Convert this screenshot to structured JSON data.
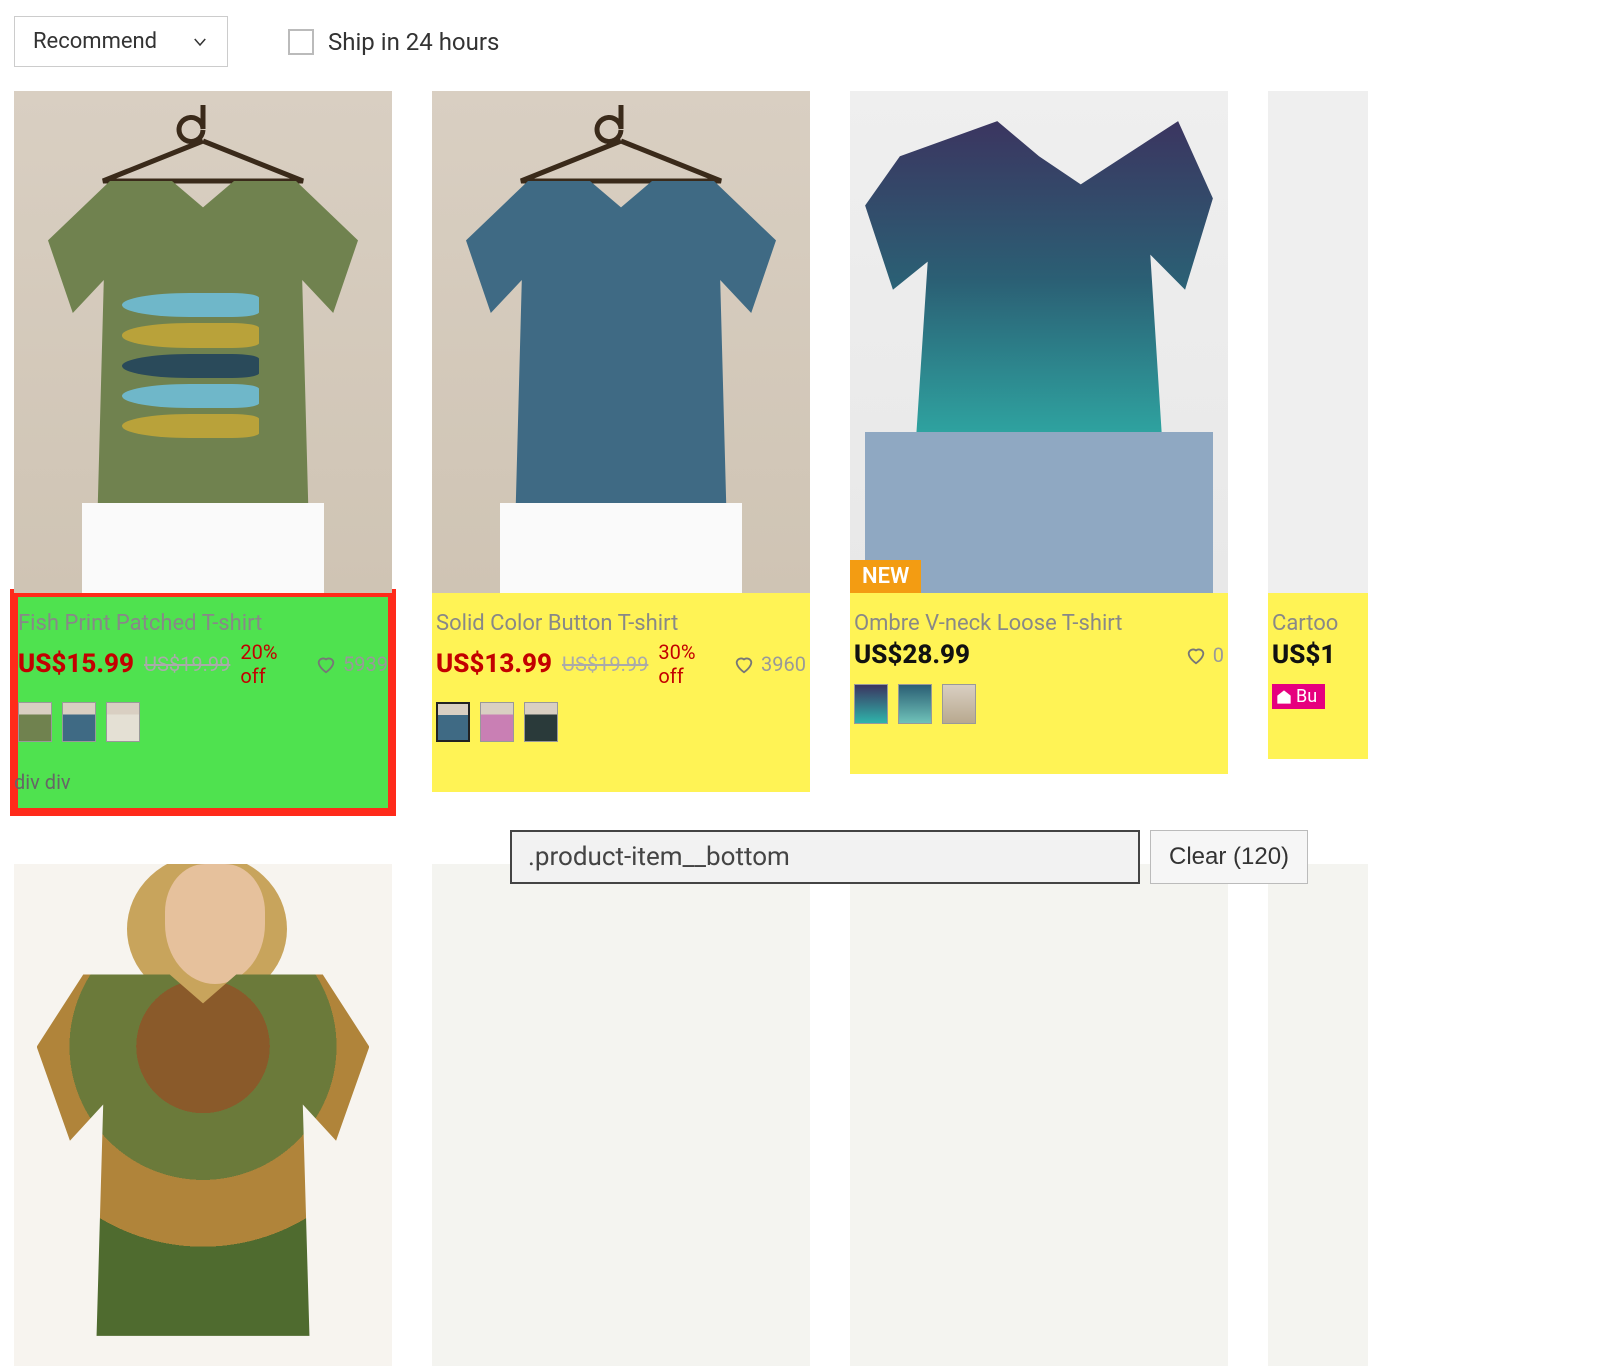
{
  "topbar": {
    "sort_label": "Recommend",
    "ship_label": "Ship in 24 hours"
  },
  "selector_bar": {
    "input_value": ".product-item__bottom",
    "clear_label": "Clear (120)"
  },
  "breadcrumb": "div div",
  "products": [
    {
      "title": "Fish Print Patched T-shirt",
      "price": "US$15.99",
      "orig": "US$19.99",
      "off": "20% off",
      "likes": "5939",
      "price_black": false,
      "swatches": [
        "#70824f",
        "#3f6a84",
        "#e4e0d4"
      ],
      "selected_swatch": -1,
      "badge": null,
      "buy_tag": null,
      "highlighted": true
    },
    {
      "title": "Solid Color Button T-shirt",
      "price": "US$13.99",
      "orig": "US$19.99",
      "off": "30% off",
      "likes": "3960",
      "price_black": false,
      "swatches": [
        "#3f6a84",
        "#c97fb4",
        "#2a3a3a"
      ],
      "selected_swatch": 0,
      "badge": null,
      "buy_tag": null,
      "highlighted": false
    },
    {
      "title": "Ombre V-neck Loose T-shirt",
      "price": "US$28.99",
      "orig": null,
      "off": null,
      "likes": "0",
      "price_black": true,
      "swatches": [
        "#2fb4ab",
        "#2b5f74",
        "#d9cfc2"
      ],
      "selected_swatch": -1,
      "badge": "NEW",
      "buy_tag": null,
      "highlighted": false
    },
    {
      "title": "Cartoo",
      "price": "US$1",
      "orig": null,
      "off": null,
      "likes": null,
      "price_black": true,
      "swatches": [],
      "selected_swatch": -1,
      "badge": null,
      "buy_tag": "Bu",
      "highlighted": false
    }
  ]
}
